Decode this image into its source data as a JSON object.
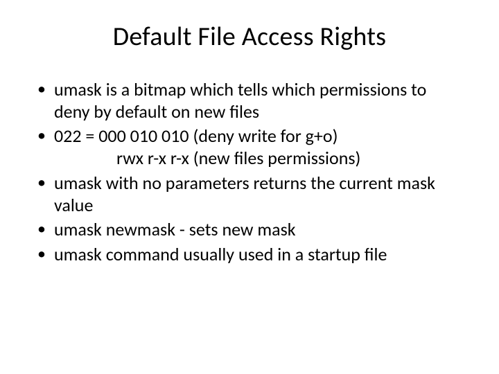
{
  "slide": {
    "title": "Default File Access Rights",
    "bullets": [
      {
        "text": "umask is a bitmap which tells which permissions to deny by default on new files"
      },
      {
        "text": "022 = 000 010 010 (deny write for g+o)",
        "sub": "rwx  r-x   r-x  (new files permissions)"
      },
      {
        "text": "umask with no parameters returns the current mask value"
      },
      {
        "text": "umask   newmask   - sets new mask"
      },
      {
        "text": "umask command usually used in a startup file"
      }
    ]
  }
}
